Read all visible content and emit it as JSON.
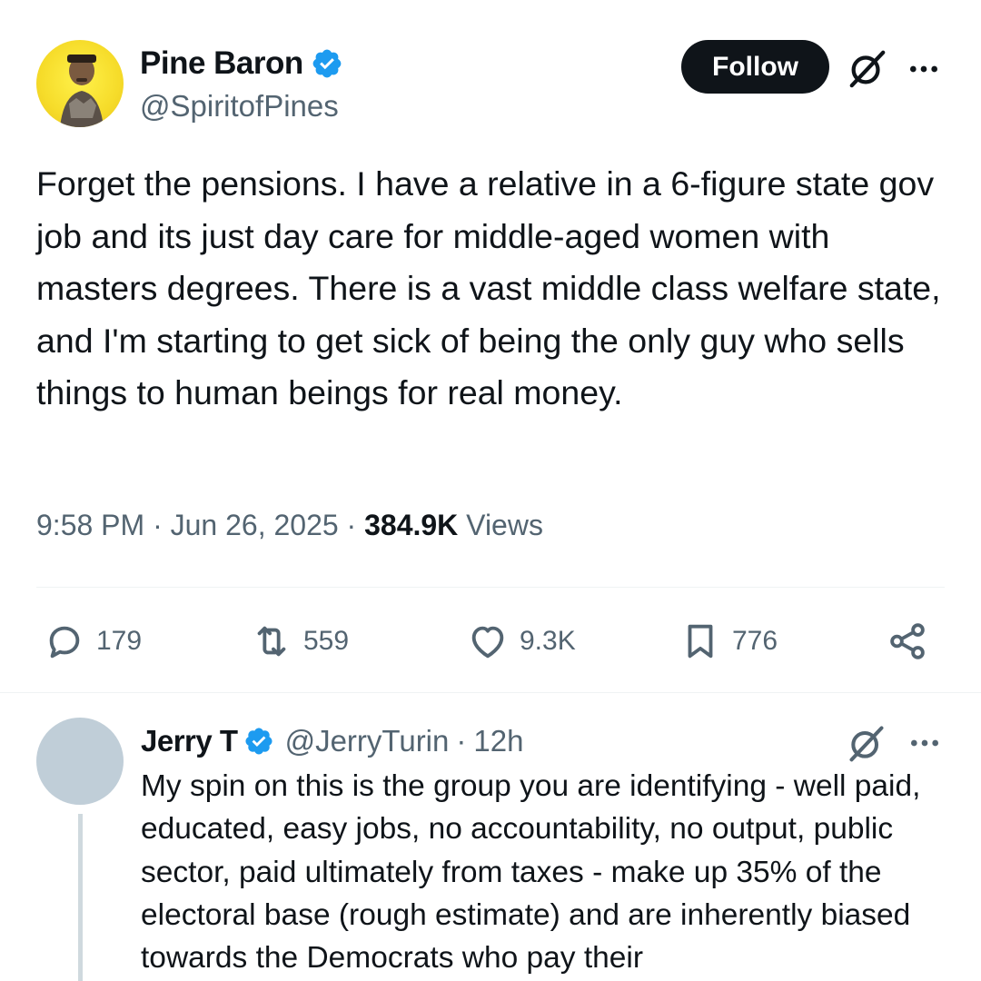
{
  "post": {
    "author": {
      "name": "Pine Baron",
      "handle": "@SpiritofPines",
      "verified": true
    },
    "follow_label": "Follow",
    "text": "Forget the pensions. I have a relative in a 6-figure state gov job and its just day care for middle-aged women with masters degrees. There is a vast middle class welfare state, and I'm starting to get sick of being the only guy who sells things to human beings for real money.",
    "time": "9:58 PM",
    "separator": "·",
    "date": "Jun 26, 2025",
    "views_count": "384.9K",
    "views_label": "Views",
    "stats": {
      "replies": "179",
      "reposts": "559",
      "likes": "9.3K",
      "bookmarks": "776"
    }
  },
  "reply": {
    "author": {
      "name": "Jerry T",
      "handle": "@JerryTurin",
      "verified": true
    },
    "separator": "·",
    "time": "12h",
    "text": "My spin on this is the group you are identifying - well paid, educated, easy jobs, no accountability, no output, public sector, paid ultimately from taxes - make up 35% of the electoral base (rough estimate) and are inherently biased towards the Democrats who pay their"
  },
  "icons": {
    "verified_badge": "verified-badge-icon",
    "grok": "grok-icon",
    "more": "more-icon",
    "reply": "reply-icon",
    "repost": "repost-icon",
    "like": "heart-icon",
    "bookmark": "bookmark-icon",
    "share": "share-icon"
  },
  "colors": {
    "text_primary": "#0f1419",
    "text_secondary": "#536471",
    "verified_blue": "#1d9bf0",
    "follow_bg": "#0f1419",
    "avatar_main_bg": "#f6dc2a",
    "avatar_reply_bg": "#c0ced8",
    "divider": "#eff3f4",
    "thread_line": "#cfd9de"
  }
}
